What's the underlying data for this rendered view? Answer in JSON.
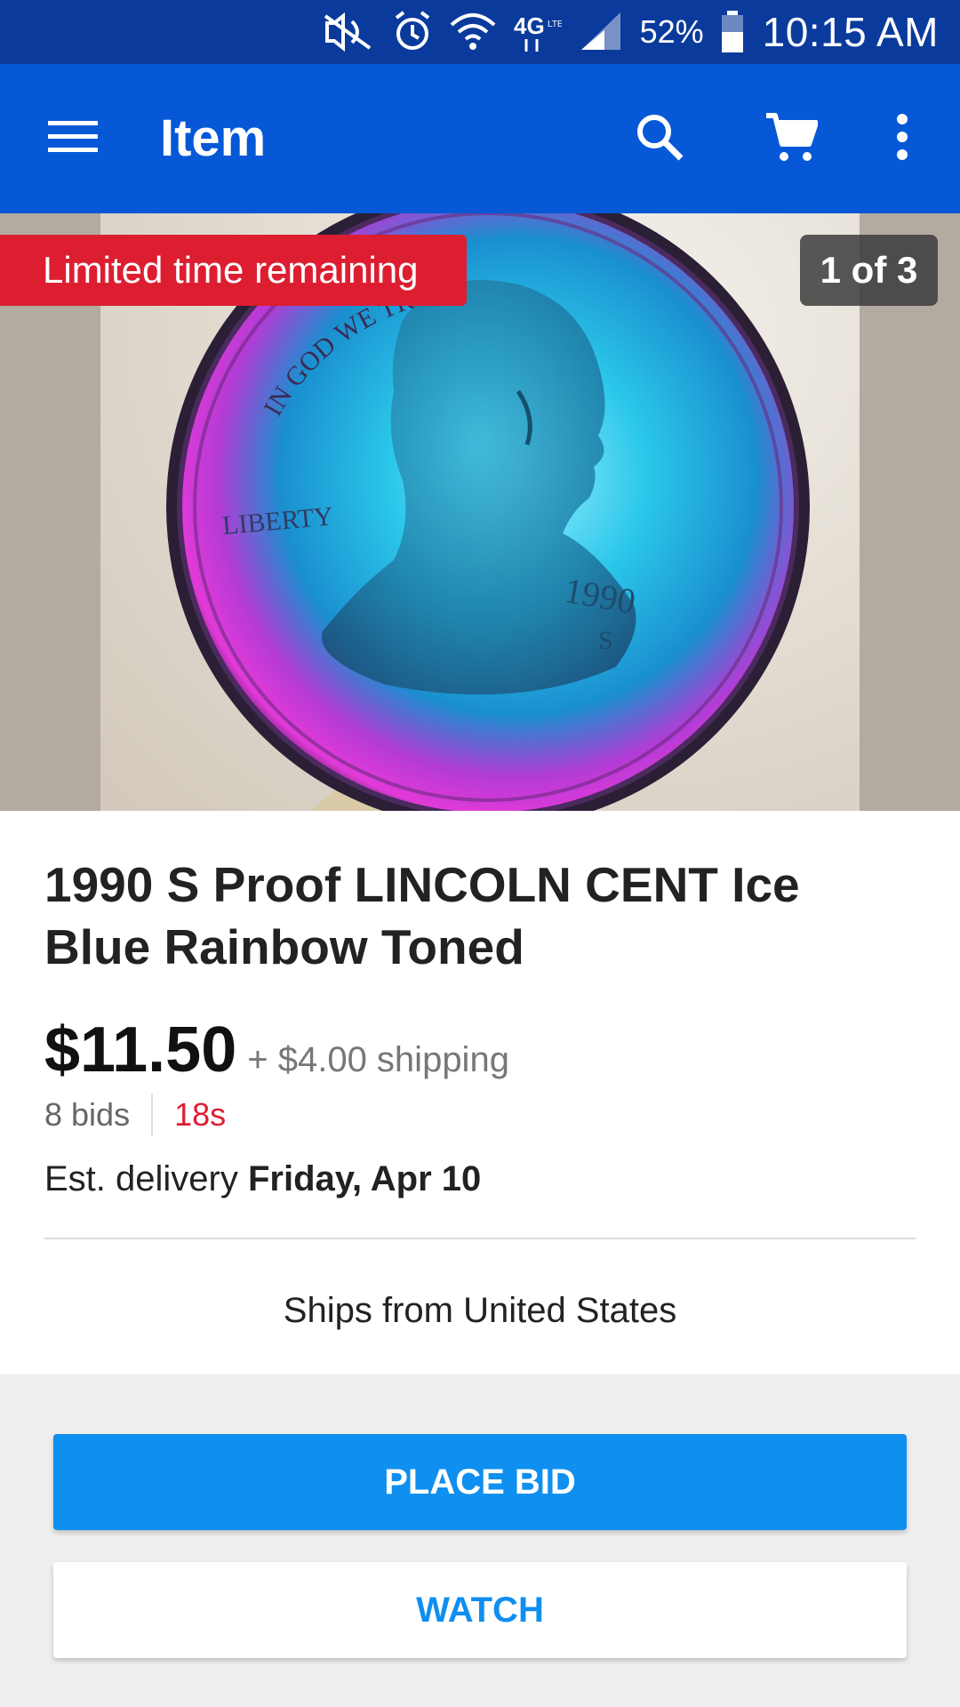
{
  "status_bar": {
    "icons": [
      "mute-icon",
      "alarm-icon",
      "wifi-icon",
      "lte-icon",
      "signal-icon",
      "battery-icon"
    ],
    "network": "4G LTE",
    "battery_percent": "52%",
    "time": "10:15 AM"
  },
  "app_bar": {
    "title": "Item",
    "icons": [
      "menu-icon",
      "search-icon",
      "cart-icon",
      "more-vert-icon"
    ]
  },
  "gallery": {
    "badge": "Limited time remaining",
    "counter": "1 of 3",
    "coin_inscriptions": [
      "IN GOD WE TRUST",
      "LIBERTY",
      "1990",
      "S"
    ]
  },
  "item": {
    "title": "1990 S Proof LINCOLN CENT Ice Blue Rainbow Toned",
    "price": "$11.50",
    "shipping": "+ $4.00 shipping",
    "bids": "8 bids",
    "time_left": "18s",
    "delivery_prefix": "Est. delivery",
    "delivery_date": "Friday, Apr 10",
    "ships_from": "Ships from United States"
  },
  "actions": {
    "place_bid": "PLACE BID",
    "watch": "WATCH"
  },
  "colors": {
    "status_bar": "#0a3a9c",
    "app_bar": "#0658d6",
    "badge_red": "#dd1e31",
    "button_blue": "#0f8fef"
  }
}
